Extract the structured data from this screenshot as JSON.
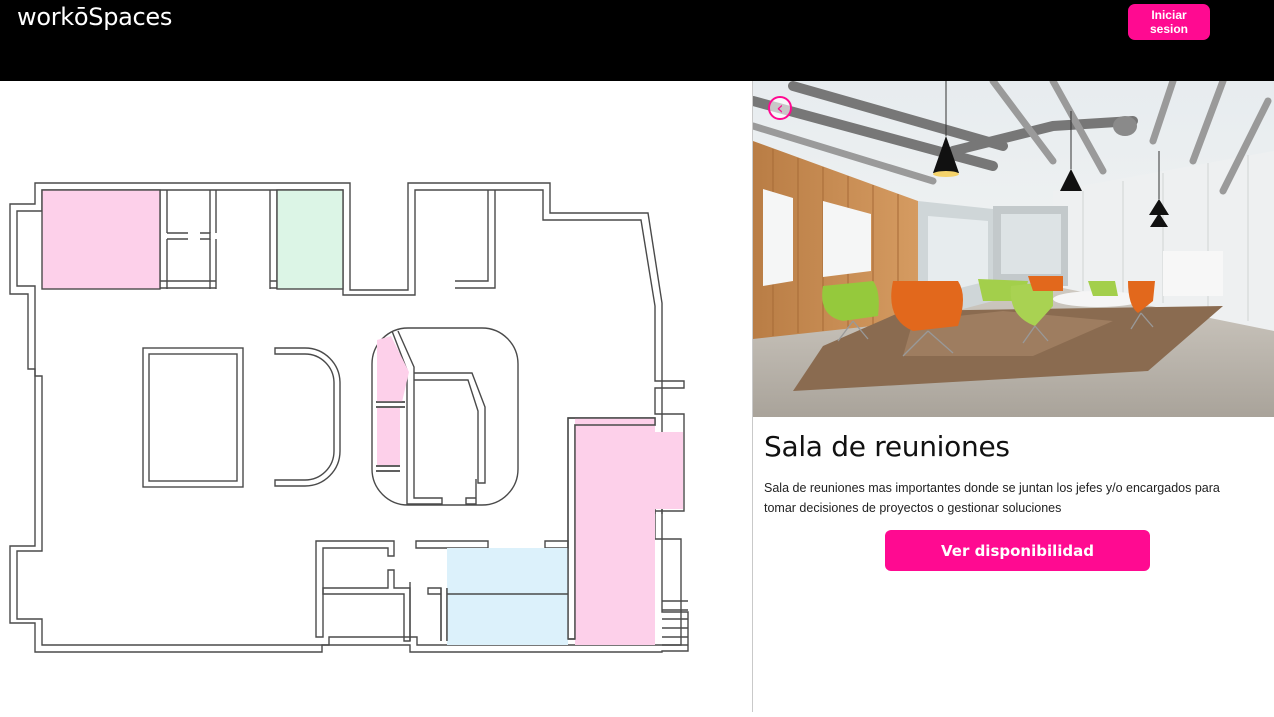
{
  "header": {
    "brand": "workōSpaces",
    "login_label": "Iniciar sesion"
  },
  "colors": {
    "accent": "#ff0a91",
    "zone_pink": "#fdd0ea",
    "zone_green": "#dcf5e6",
    "zone_blue": "#dcf1fb",
    "header_bg": "#000000"
  },
  "floorplan": {
    "zones": [
      {
        "name": "room-pink-top-left",
        "status": "selected"
      },
      {
        "name": "room-green-top",
        "status": "available"
      },
      {
        "name": "room-pink-center-upper",
        "status": "selected"
      },
      {
        "name": "room-pink-center-lower",
        "status": "selected"
      },
      {
        "name": "room-pink-right",
        "status": "selected"
      },
      {
        "name": "room-blue-bottom",
        "status": "available"
      }
    ]
  },
  "detail": {
    "back_icon": "chevron-left-icon",
    "photo_alt": "Sala de reuniones",
    "title": "Sala de reuniones",
    "description": "Sala de reuniones mas importantes donde se juntan los jefes y/o encargados para tomar decisiones de proyectos o gestionar soluciones",
    "cta_label": "Ver disponibilidad"
  }
}
